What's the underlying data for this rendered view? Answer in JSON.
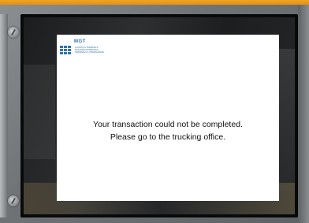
{
  "kiosk": {
    "logo": {
      "name": "MGT",
      "subtext": [
        "LOGISTICS TERMINALS",
        "MARITIME INTERMODAL",
        "TERMINALS & INTERCHANGE"
      ],
      "color": "#2f73b5"
    },
    "message": {
      "line1": "Your transaction could not be completed.",
      "line2": "Please go to the trucking office."
    },
    "colors": {
      "frame_stripe": "#f1a31f",
      "bezel": "#7a7e81",
      "screen_background": "#ffffff",
      "text": "#111111"
    }
  }
}
